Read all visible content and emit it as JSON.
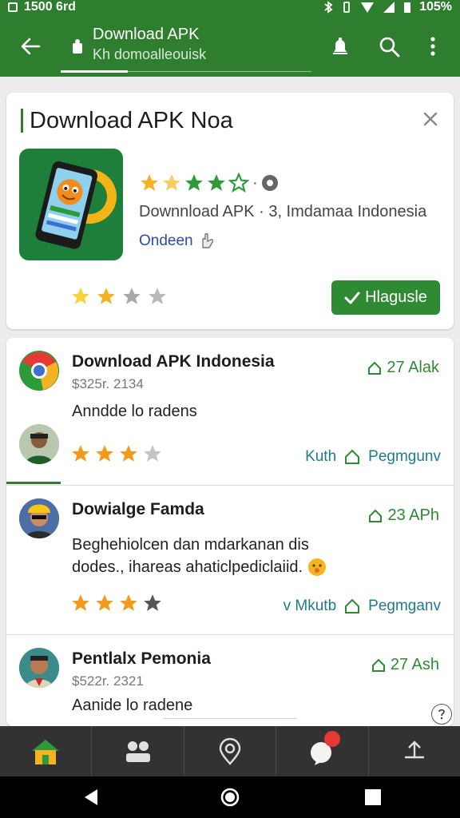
{
  "status_bar": {
    "time": "1500 6rd",
    "battery": "105%"
  },
  "app_bar": {
    "title": "Download APK",
    "subtitle": "Kh domoalleouisk"
  },
  "featured": {
    "heading": "Download APK Noa",
    "meta": "Downnload APK · 3,  Imdamaa Indonesia",
    "developer": "Ondeen",
    "install_label": "Hlagusle",
    "rating_stars": 4,
    "user_rating": 2
  },
  "reviews": [
    {
      "name": "Download APK Indonesia",
      "sub": "$325r. 2134",
      "desc": "Anndde lo radens",
      "stat": "27 Alak",
      "stars": 3,
      "action_1": "Kuth",
      "action_2": "Pegmgunv"
    },
    {
      "name": "Dowialge Famda",
      "desc_line1": "Beghehiolcen dan mdarkanan dis",
      "desc_line2": "dodes., ihareas ahaticlpediclaiid.",
      "stat": "23 APh",
      "stars": 3,
      "action_1": "Mkutb",
      "action_2": "Pegmganv"
    },
    {
      "name": "Pentlalx Pemonia",
      "sub": "$522r. 2321",
      "desc": "Aanide lo radene",
      "stat": "27 Ash"
    }
  ],
  "colors": {
    "brand_green": "#2f7d2f",
    "install_green": "#2f8a34",
    "star_gold": "#f5b324",
    "star_green": "#2e9b3a",
    "action_teal": "#1f7a8c"
  }
}
